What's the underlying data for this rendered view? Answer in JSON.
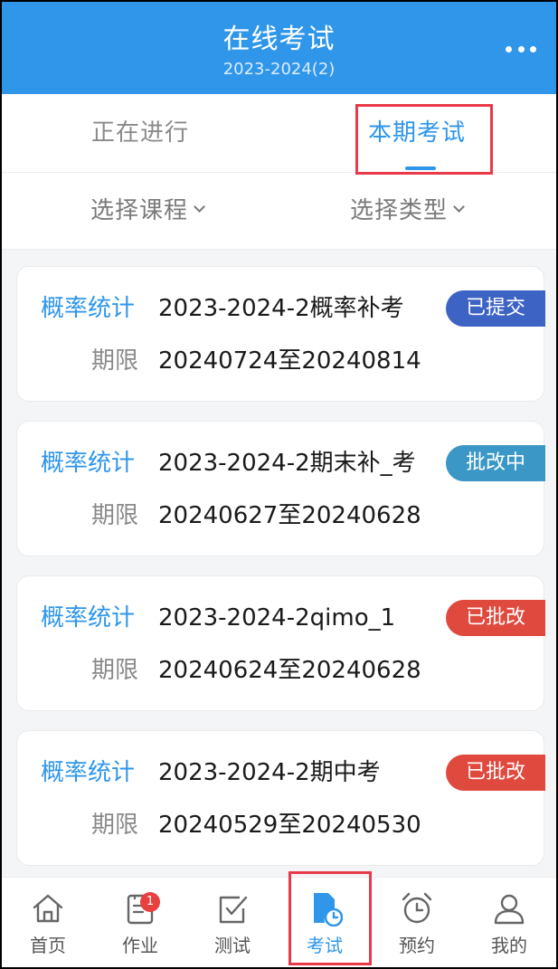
{
  "header": {
    "title": "在线考试",
    "subtitle": "2023-2024(2)",
    "more_icon": "more-icon"
  },
  "tabs": [
    {
      "label": "正在进行",
      "active": false
    },
    {
      "label": "本期考试",
      "active": true
    }
  ],
  "filters": {
    "course": "选择课程",
    "type": "选择类型"
  },
  "period_label": "期限",
  "exams": [
    {
      "course": "概率统计",
      "name": "2023-2024-2概率补考",
      "period": "20240724至20240814",
      "status": "已提交",
      "status_color": "#3d63c4"
    },
    {
      "course": "概率统计",
      "name": "2023-2024-2期末补_考",
      "period": "20240627至20240628",
      "status": "批改中",
      "status_color": "#3b98c6"
    },
    {
      "course": "概率统计",
      "name": "2023-2024-2qimo_1",
      "period": "20240624至20240628",
      "status": "已批改",
      "status_color": "#e0493d"
    },
    {
      "course": "概率统计",
      "name": "2023-2024-2期中考",
      "period": "20240529至20240530",
      "status": "已批改",
      "status_color": "#e0493d"
    }
  ],
  "nav": [
    {
      "label": "首页",
      "icon": "home-icon"
    },
    {
      "label": "作业",
      "icon": "homework-icon",
      "badge": "1"
    },
    {
      "label": "测试",
      "icon": "test-icon"
    },
    {
      "label": "考试",
      "icon": "exam-icon",
      "active": true
    },
    {
      "label": "预约",
      "icon": "alarm-icon"
    },
    {
      "label": "我的",
      "icon": "user-icon"
    }
  ],
  "colors": {
    "primary": "#2f96ea",
    "highlight": "#e8394a",
    "badge": "#e83f3f"
  }
}
